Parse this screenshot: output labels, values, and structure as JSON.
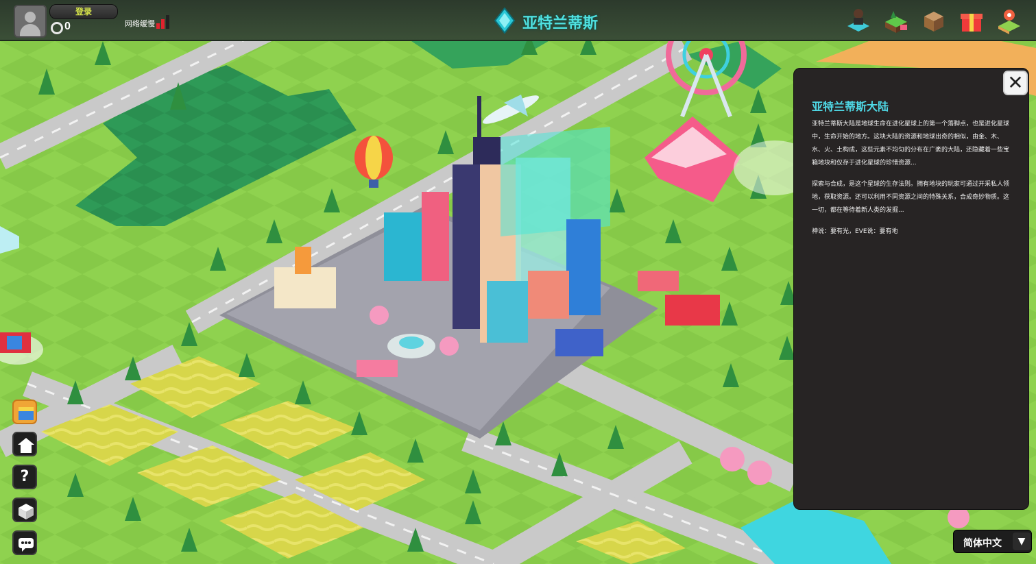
{
  "game": {
    "world_title": "亚特兰蒂斯",
    "accent_color": "#4fe0e0"
  },
  "topbar": {
    "login_label": "登录",
    "coin_count": "0",
    "network_label": "网络缓慢",
    "icons": [
      "avatar-icon",
      "network-signal-icon",
      "atlantis-crystal-icon",
      "player-desk-icon",
      "land-shop-icon",
      "treasure-chest-icon",
      "gift-box-icon",
      "map-location-icon"
    ]
  },
  "sidebar": {
    "buttons": [
      {
        "icon": "treasure-box-icon"
      },
      {
        "icon": "home-icon"
      },
      {
        "icon": "help-icon"
      },
      {
        "icon": "cube-icon"
      },
      {
        "icon": "chat-icon"
      }
    ]
  },
  "panel": {
    "title": "亚特兰蒂斯大陆",
    "paragraph1": "亚特兰蒂斯大陆是地球生命在进化星球上的第一个落脚点，也是进化星球中，生命开始的地方。这块大陆的资源和地球出奇的相似，由金、木、水、火、土构成，这些元素不均匀的分布在广袤的大陆，还隐藏着一些宝箱地块和仅存于进化星球的珍惜资源...",
    "paragraph2": "探索与合成，是这个星球的生存法则。拥有地块的玩家可通过开采私人领地，获取资源。还可以利用不同资源之间的特殊关系，合成奇妙物质。这一切，都在等待着新人类的发掘...",
    "paragraph3": "神说：要有光，EVE说：要有地",
    "close_icon": "close-icon"
  },
  "language": {
    "selected": "简体中文",
    "arrow_icon": "chevron-down-icon"
  }
}
